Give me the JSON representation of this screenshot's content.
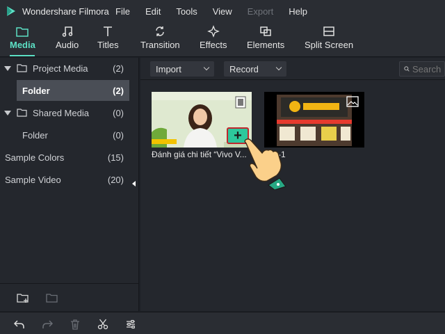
{
  "app": {
    "title": "Wondershare Filmora",
    "logo_icon": "filmora-logo-icon"
  },
  "menu": [
    {
      "label": "File",
      "disabled": false
    },
    {
      "label": "Edit",
      "disabled": false
    },
    {
      "label": "Tools",
      "disabled": false
    },
    {
      "label": "View",
      "disabled": false
    },
    {
      "label": "Export",
      "disabled": true
    },
    {
      "label": "Help",
      "disabled": false
    }
  ],
  "toolbar": {
    "active": "Media",
    "accent_color": "#5ce0c5",
    "items": [
      {
        "label": "Media",
        "icon": "folder-icon"
      },
      {
        "label": "Audio",
        "icon": "music-note-icon"
      },
      {
        "label": "Titles",
        "icon": "text-t-icon"
      },
      {
        "label": "Transition",
        "icon": "transition-icon"
      },
      {
        "label": "Effects",
        "icon": "sparkle-icon"
      },
      {
        "label": "Elements",
        "icon": "elements-icon"
      },
      {
        "label": "Split Screen",
        "icon": "split-screen-icon"
      }
    ]
  },
  "sidebar": {
    "project_media": {
      "label": "Project Media",
      "count": "(2)"
    },
    "folder_selected": {
      "label": "Folder",
      "count": "(2)"
    },
    "shared_media": {
      "label": "Shared Media",
      "count": "(0)"
    },
    "shared_folder": {
      "label": "Folder",
      "count": "(0)"
    },
    "sample_colors": {
      "label": "Sample Colors",
      "count": "(15)"
    },
    "sample_video": {
      "label": "Sample Video",
      "count": "(20)"
    }
  },
  "media_bar": {
    "import_label": "Import",
    "record_label": "Record",
    "search_placeholder": "Search"
  },
  "clips": [
    {
      "name": "Đánh giá chi tiết “Vivo V...",
      "type_icon": "video-clip-icon"
    },
    {
      "name": "-1",
      "type_icon": "image-icon"
    }
  ],
  "add_button": {
    "label": "+",
    "color": "#2dc79c",
    "border_color": "#c0272d"
  },
  "bottom_tools": [
    "undo-icon",
    "redo-icon",
    "delete-icon",
    "scissors-icon",
    "adjust-icon"
  ]
}
